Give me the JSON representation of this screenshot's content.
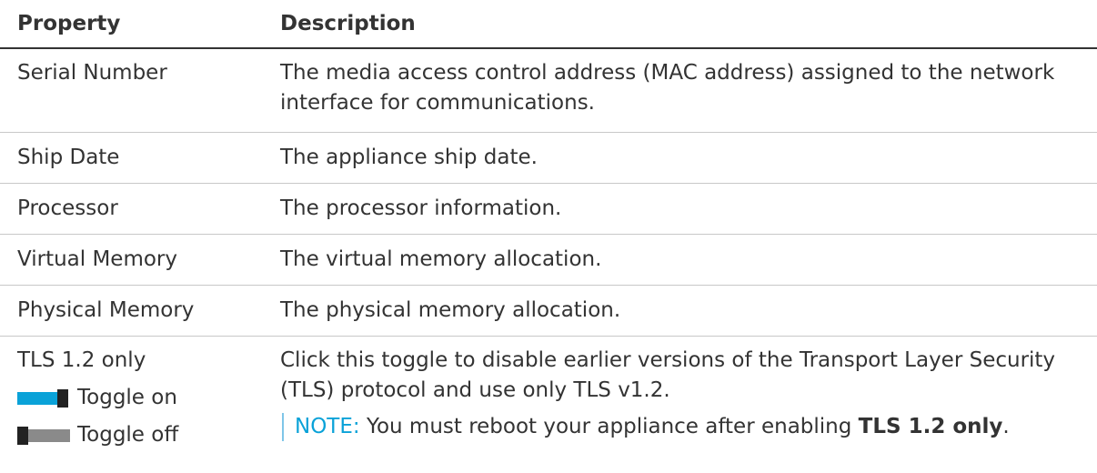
{
  "table": {
    "headers": {
      "property": "Property",
      "description": "Description"
    },
    "rows": [
      {
        "property": "Serial Number",
        "description": "The media access control address (MAC address) assigned to the network interface for communications."
      },
      {
        "property": "Ship Date",
        "description": "The appliance ship date."
      },
      {
        "property": "Processor",
        "description": "The processor information."
      },
      {
        "property": "Virtual Memory",
        "description": "The virtual memory allocation."
      },
      {
        "property": "Physical Memory",
        "description": "The physical memory allocation."
      }
    ],
    "tls": {
      "property": "TLS 1.2 only",
      "toggle_on_label": "Toggle on",
      "toggle_off_label": "Toggle off",
      "description": "Click this toggle to disable earlier versions of the Transport Layer Security (TLS) protocol and use only TLS v1.2.",
      "note_label": "NOTE:",
      "note_text": "You must reboot your appliance after enabling",
      "note_bold": "TLS 1.2 only",
      "note_end": "."
    }
  },
  "colors": {
    "toggle_on": "#0aa2d8",
    "toggle_off": "#8a8a8a",
    "note_accent": "#0aa2d8",
    "text": "#333333"
  },
  "icons": {
    "toggle_on": "toggle-on-icon",
    "toggle_off": "toggle-off-icon"
  }
}
